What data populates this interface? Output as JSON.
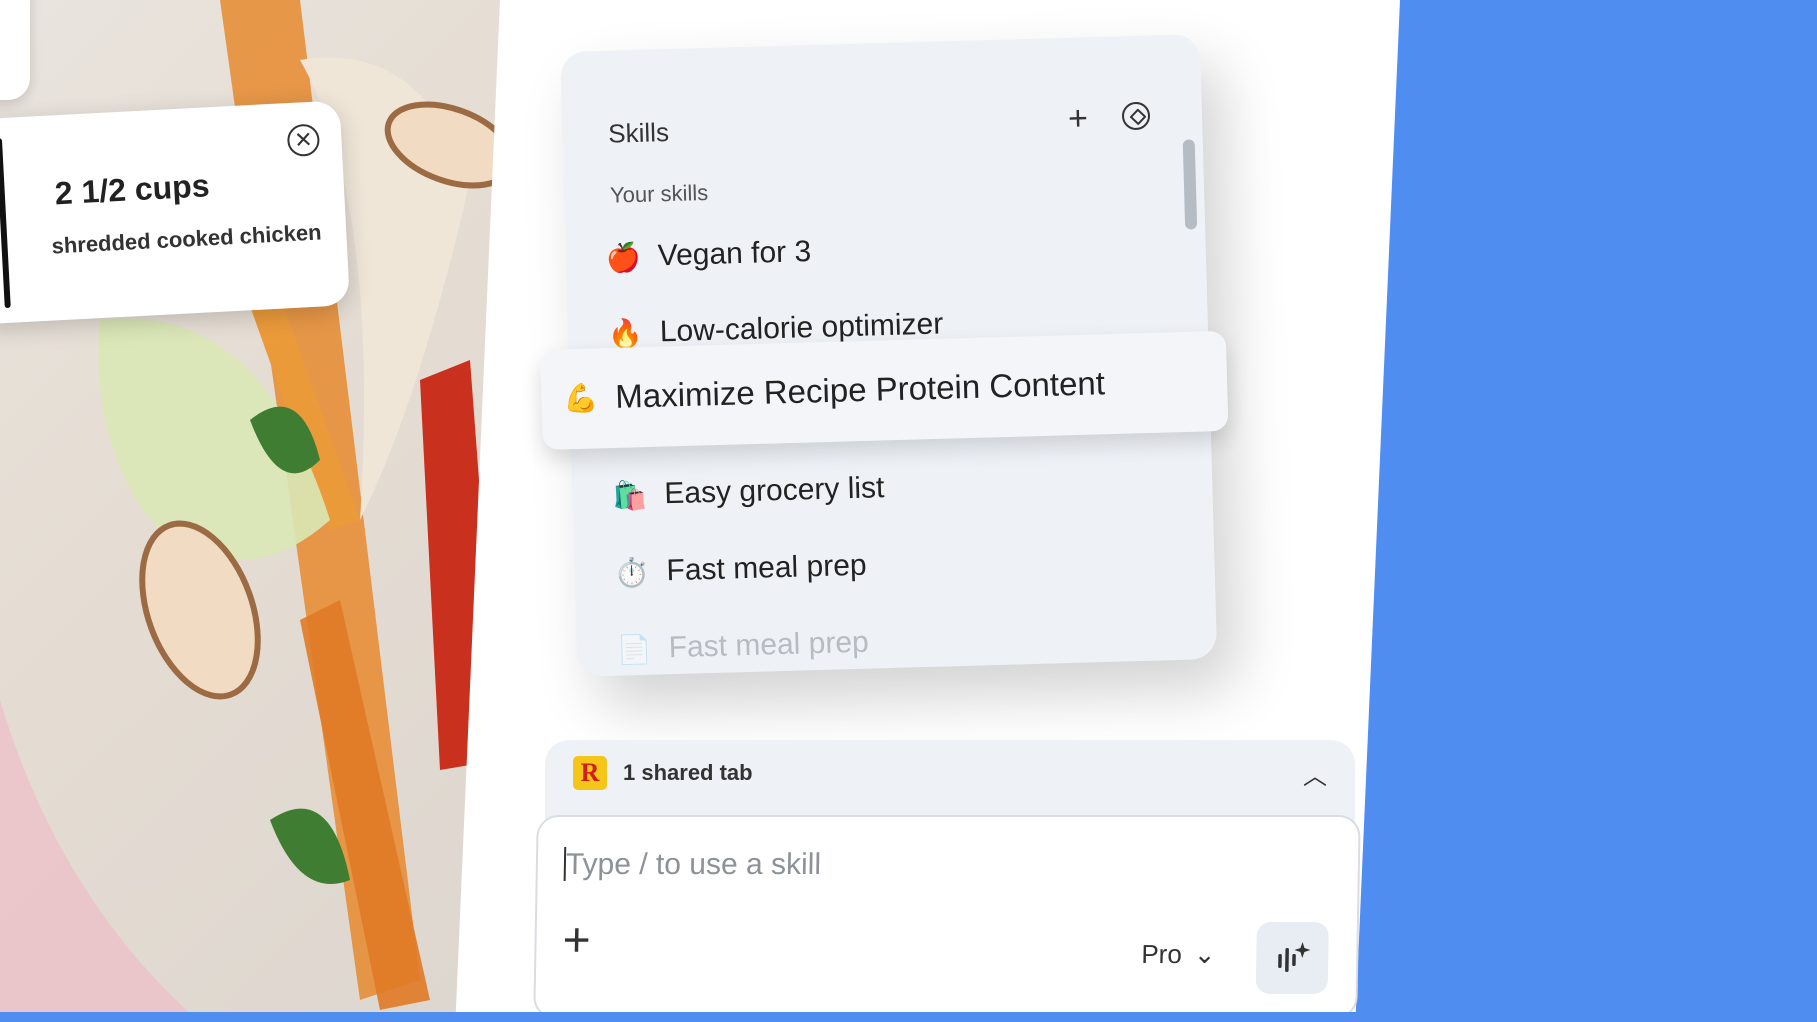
{
  "ingredient": {
    "amount": "2 1/2 cups",
    "description": "shredded cooked chicken",
    "close_icon": "close-circle-icon"
  },
  "skills": {
    "title": "Skills",
    "section_label": "Your skills",
    "add_icon": "plus-icon",
    "browse_icon": "compass-icon",
    "items": [
      {
        "emoji": "🍎",
        "label": "Vegan for 3"
      },
      {
        "emoji": "🔥",
        "label": "Low-calorie optimizer"
      },
      {
        "emoji": "💪",
        "label": "Maximize Recipe Protein Content"
      },
      {
        "emoji": "🛍️",
        "label": "Easy grocery list"
      },
      {
        "emoji": "⏱️",
        "label": "Fast meal prep"
      },
      {
        "emoji": "📄",
        "label": "Fast meal prep"
      }
    ],
    "highlighted_index": 2
  },
  "composer": {
    "shared_tabs_label": "1 shared tab",
    "shared_tab_logo": "R",
    "placeholder": "Type / to use a skill",
    "model_label": "Pro"
  },
  "colors": {
    "background_accent": "#4f8ef0",
    "popup_bg": "#eef2f7"
  }
}
